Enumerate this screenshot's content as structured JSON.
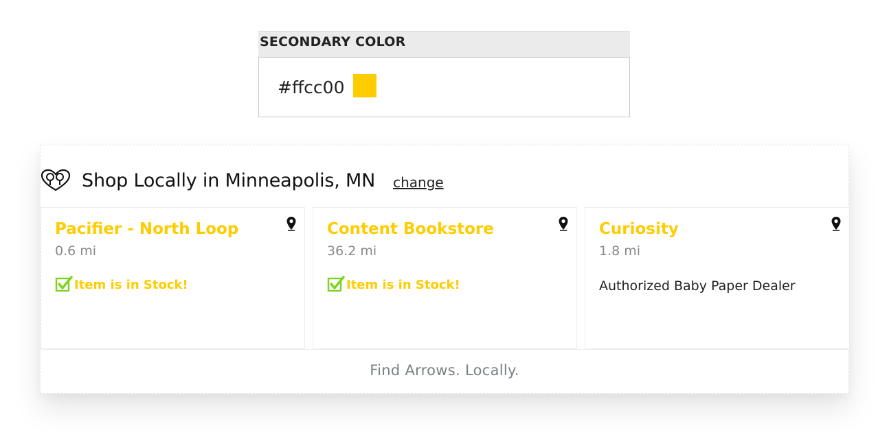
{
  "secondary_color": {
    "label": "SECONDARY COLOR",
    "value": "#ffcc00",
    "swatch_color": "#ffcc00"
  },
  "widget": {
    "title": "Shop Locally in Minneapolis, MN",
    "change_label": "change",
    "logo_icon": "heart-pin-logo-icon",
    "stores": [
      {
        "name": "Pacifier - North Loop",
        "distance": "0.6 mi",
        "stock_text": "Item is in Stock!",
        "note": ""
      },
      {
        "name": "Content Bookstore",
        "distance": "36.2 mi",
        "stock_text": "Item is in Stock!",
        "note": ""
      },
      {
        "name": "Curiosity",
        "distance": "1.8 mi",
        "stock_text": "",
        "note": "Authorized Baby Paper Dealer"
      }
    ],
    "footer": "Find Arrows. Locally."
  },
  "colors": {
    "accent": "#ffcc00",
    "check": "#7ed321",
    "muted": "#888888"
  }
}
